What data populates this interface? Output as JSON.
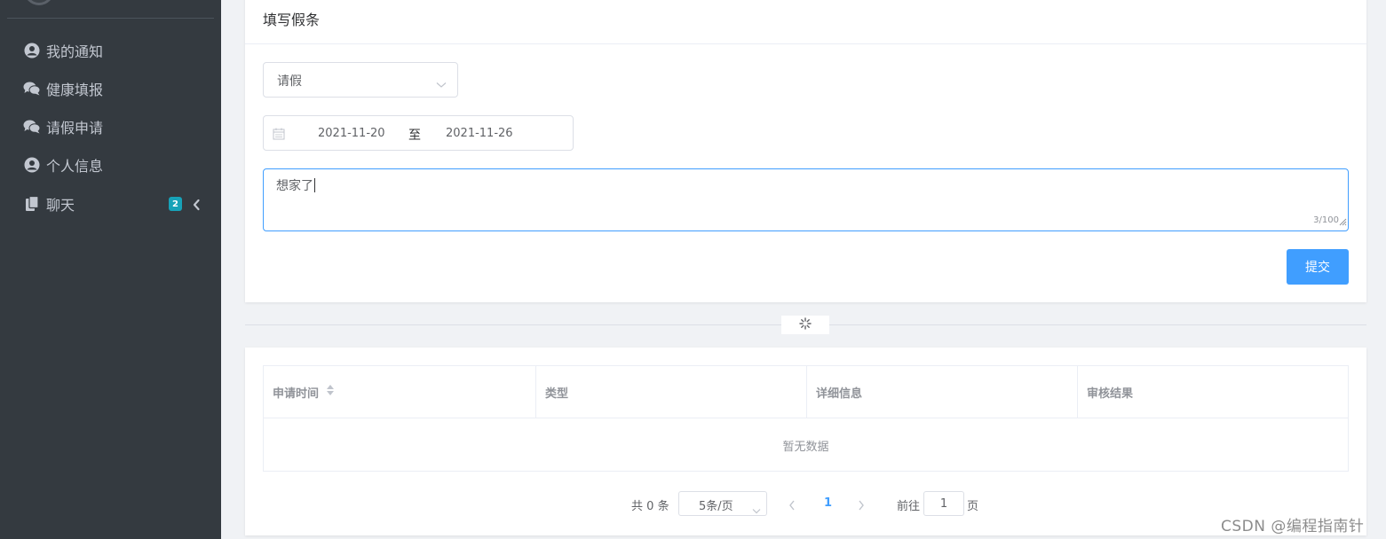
{
  "sidebar": {
    "items": [
      {
        "label": "我的通知",
        "icon": "user-circle-icon"
      },
      {
        "label": "健康填报",
        "icon": "comments-icon"
      },
      {
        "label": "请假申请",
        "icon": "comments-icon"
      },
      {
        "label": "个人信息",
        "icon": "user-circle-icon"
      },
      {
        "label": "聊天",
        "icon": "copy-icon",
        "badge": "2"
      }
    ]
  },
  "form": {
    "title": "填写假条",
    "type_select": {
      "value": "请假"
    },
    "date_range": {
      "start": "2021-11-20",
      "separator": "至",
      "end": "2021-11-26"
    },
    "reason": {
      "value": "想家了",
      "counter": "3/100"
    },
    "submit_label": "提交"
  },
  "table": {
    "columns": [
      "申请时间",
      "类型",
      "详细信息",
      "审核结果"
    ],
    "empty_text": "暂无数据"
  },
  "pagination": {
    "total_prefix": "共",
    "total_count": "0",
    "total_suffix": "条",
    "page_size": "5条/页",
    "current_page": "1",
    "goto_label": "前往",
    "goto_value": "1",
    "goto_suffix": "页"
  },
  "watermark": "CSDN @编程指南针",
  "colors": {
    "sidebar_bg": "#343a40",
    "primary": "#409eff",
    "badge": "#17a2b8"
  }
}
